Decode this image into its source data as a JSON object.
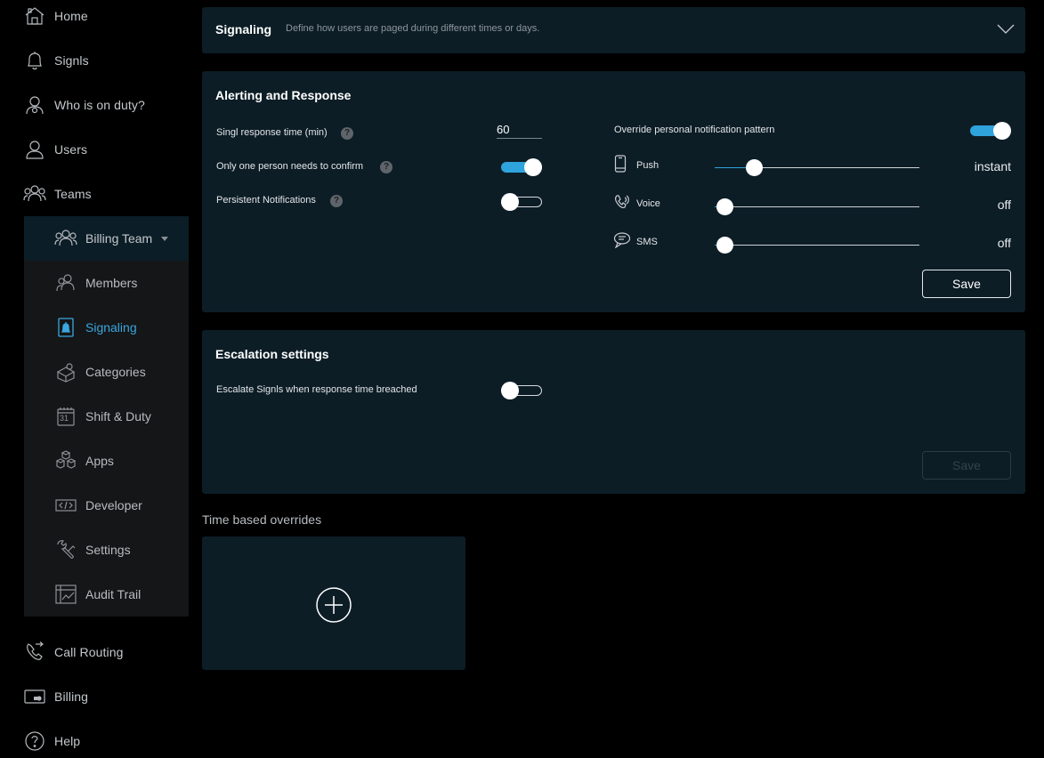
{
  "sidebar": {
    "items": [
      {
        "label": "Home",
        "icon": "home-icon"
      },
      {
        "label": "Signls",
        "icon": "bell-icon"
      },
      {
        "label": "Who is on duty?",
        "icon": "on-duty-icon"
      },
      {
        "label": "Users",
        "icon": "user-icon"
      },
      {
        "label": "Teams",
        "icon": "teams-icon"
      }
    ],
    "team": {
      "name": "Billing Team",
      "subitems": [
        {
          "label": "Members",
          "icon": "members-icon"
        },
        {
          "label": "Signaling",
          "icon": "signaling-icon",
          "active": true
        },
        {
          "label": "Categories",
          "icon": "categories-icon"
        },
        {
          "label": "Shift & Duty",
          "icon": "calendar-icon",
          "calendar_day": "31"
        },
        {
          "label": "Apps",
          "icon": "apps-icon"
        },
        {
          "label": "Developer",
          "icon": "code-icon"
        },
        {
          "label": "Settings",
          "icon": "wrench-icon"
        },
        {
          "label": "Audit Trail",
          "icon": "audit-icon"
        }
      ]
    },
    "bottom_items": [
      {
        "label": "Call Routing",
        "icon": "call-routing-icon"
      },
      {
        "label": "Billing",
        "icon": "billing-icon"
      },
      {
        "label": "Help",
        "icon": "help-icon"
      }
    ]
  },
  "signaling": {
    "title": "Signaling",
    "description": "Define how users are paged during different times or days.",
    "expanded": false
  },
  "alerting": {
    "title": "Alerting and Response",
    "response_time_label": "Singl response time (min)",
    "response_time_value": "60",
    "one_confirm_label": "Only one person needs to confirm",
    "one_confirm_on": true,
    "persistent_label": "Persistent Notifications",
    "persistent_on": false,
    "help_glyph": "?",
    "override_label": "Override personal notification pattern",
    "override_on": true,
    "channels": [
      {
        "label": "Push",
        "icon": "phone-icon",
        "value": "instant",
        "level": 0.16
      },
      {
        "label": "Voice",
        "icon": "voice-icon",
        "value": "off",
        "level": 0.0
      },
      {
        "label": "SMS",
        "icon": "sms-icon",
        "value": "off",
        "level": 0.0
      }
    ],
    "save_label": "Save"
  },
  "escalation": {
    "title": "Escalation settings",
    "escalate_label": "Escalate Signls when response time breached",
    "escalate_on": false,
    "save_label": "Save",
    "save_enabled": false
  },
  "overrides": {
    "title": "Time based overrides",
    "add_icon": "plus-circle-icon"
  },
  "colors": {
    "accent": "#2fa3dc",
    "card_bg": "#0c1d26",
    "active_nav": "#3ba7e0"
  }
}
